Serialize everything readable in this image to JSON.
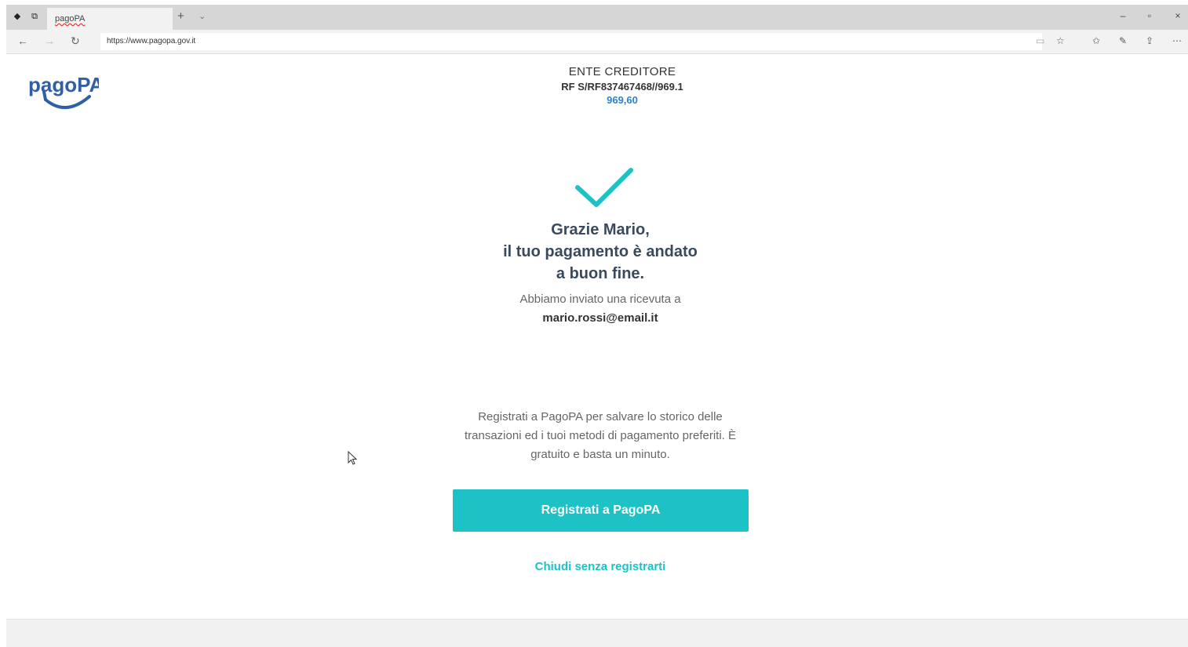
{
  "browser": {
    "tab_title": "pagoPA",
    "new_tab": "+",
    "tab_menu": "⌄",
    "url": "https://www.pagopa.gov.it",
    "controls": {
      "minimize": "–",
      "maximize": "▫",
      "close": "×"
    }
  },
  "logo": {
    "text": "pagoPA",
    "color": "#2f5fa5"
  },
  "creditor": {
    "title": "ENTE CREDITORE",
    "reference": "RF S/RF837467468//969.1",
    "amount": "969,60"
  },
  "success": {
    "line1": "Grazie Mario,",
    "line2": "il tuo pagamento è andato",
    "line3": "a buon fine.",
    "receipt_text": "Abbiamo inviato una ricevuta a",
    "email": "mario.rossi@email.it"
  },
  "register": {
    "text": "Registrati a PagoPA per salvare lo storico delle transazioni ed i tuoi metodi di pagamento preferiti. È gratuito e basta un minuto.",
    "button_label": "Registrati a PagoPA",
    "close_link": "Chiudi senza registrarti"
  },
  "colors": {
    "accent": "#1cc2c6",
    "amount": "#2f80d1",
    "heading": "#3a4a5c"
  }
}
